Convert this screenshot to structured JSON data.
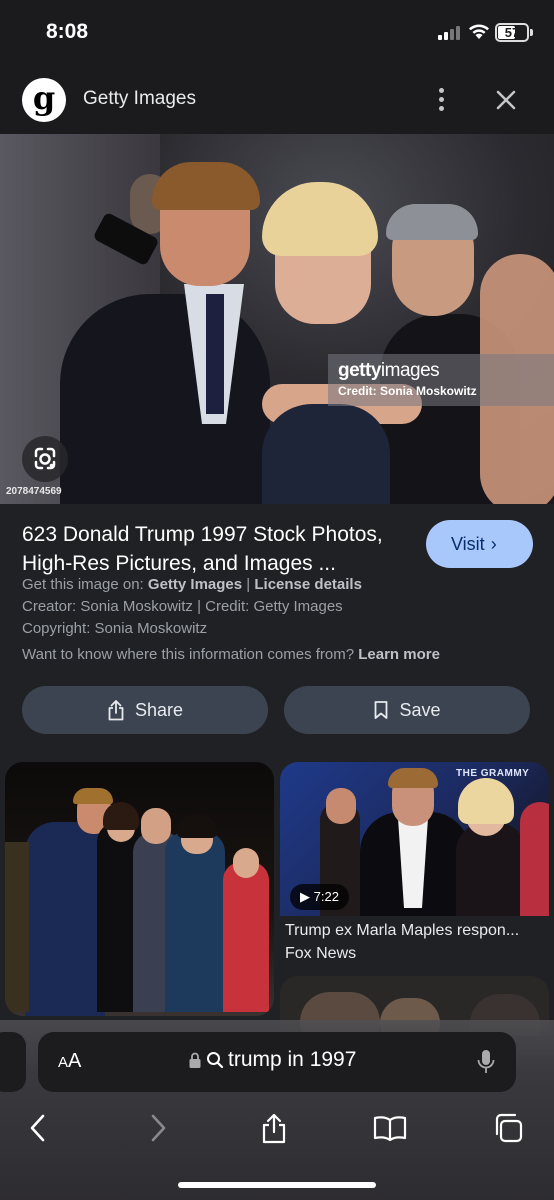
{
  "status_bar": {
    "time": "8:08",
    "battery": "57"
  },
  "header": {
    "logo_letter": "g",
    "site_name": "Getty Images"
  },
  "hero_image": {
    "watermark_brand_bold": "getty",
    "watermark_brand_light": "images",
    "watermark_credit": "Credit: Sonia Moskowitz",
    "image_id": "2078474569"
  },
  "result": {
    "title": "623 Donald Trump 1997 Stock Photos, High-Res Pictures, and Images ...",
    "visit_label": "Visit",
    "get_image_prefix": "Get this image on:",
    "get_image_source": "Getty Images",
    "separator": "|",
    "license_label": "License details",
    "creator_line": "Creator: Sonia Moskowitz | Credit: Getty Images",
    "copyright_line": "Copyright: Sonia Moskowitz",
    "info_question": "Want to know where this information comes from?",
    "learn_more": "Learn more"
  },
  "actions": {
    "share_label": "Share",
    "save_label": "Save"
  },
  "related": {
    "video_duration": "7:22",
    "video_title": "Trump ex Marla Maples respon...",
    "video_source": "Fox News",
    "banner_text": "THE GRAMMY"
  },
  "address_bar": {
    "aa_small": "A",
    "aa_big": "A",
    "query": "trump in 1997"
  }
}
